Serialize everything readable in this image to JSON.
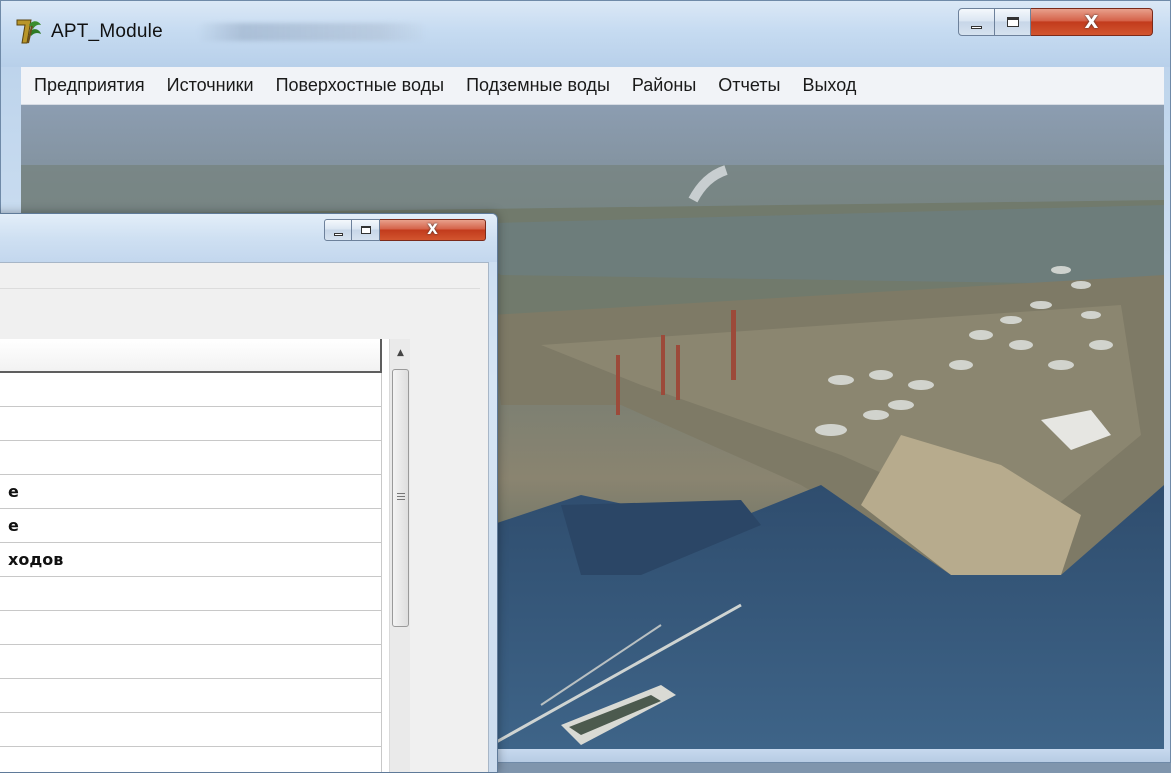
{
  "main_window": {
    "title": "APT_Module",
    "menu": [
      "Предприятия",
      "Источники",
      "Поверхостные воды",
      "Подземные воды",
      "Районы",
      "Отчеты",
      "Выход"
    ],
    "caption_buttons": {
      "minimize_icon": "minimize-icon",
      "maximize_icon": "maximize-icon",
      "close_glyph": "X"
    },
    "background_image": "aerial-photo-industrial-port"
  },
  "child_window": {
    "caption_buttons": {
      "minimize_icon": "minimize-icon",
      "maximize_icon": "maximize-icon",
      "close_glyph": "X"
    },
    "grid": {
      "rows": [
        "",
        "",
        "",
        "е",
        "е",
        "ходов",
        "",
        "",
        "",
        "",
        "",
        ""
      ]
    },
    "scrollbar": {
      "up_arrow": "▲",
      "grip": "≡"
    }
  }
}
